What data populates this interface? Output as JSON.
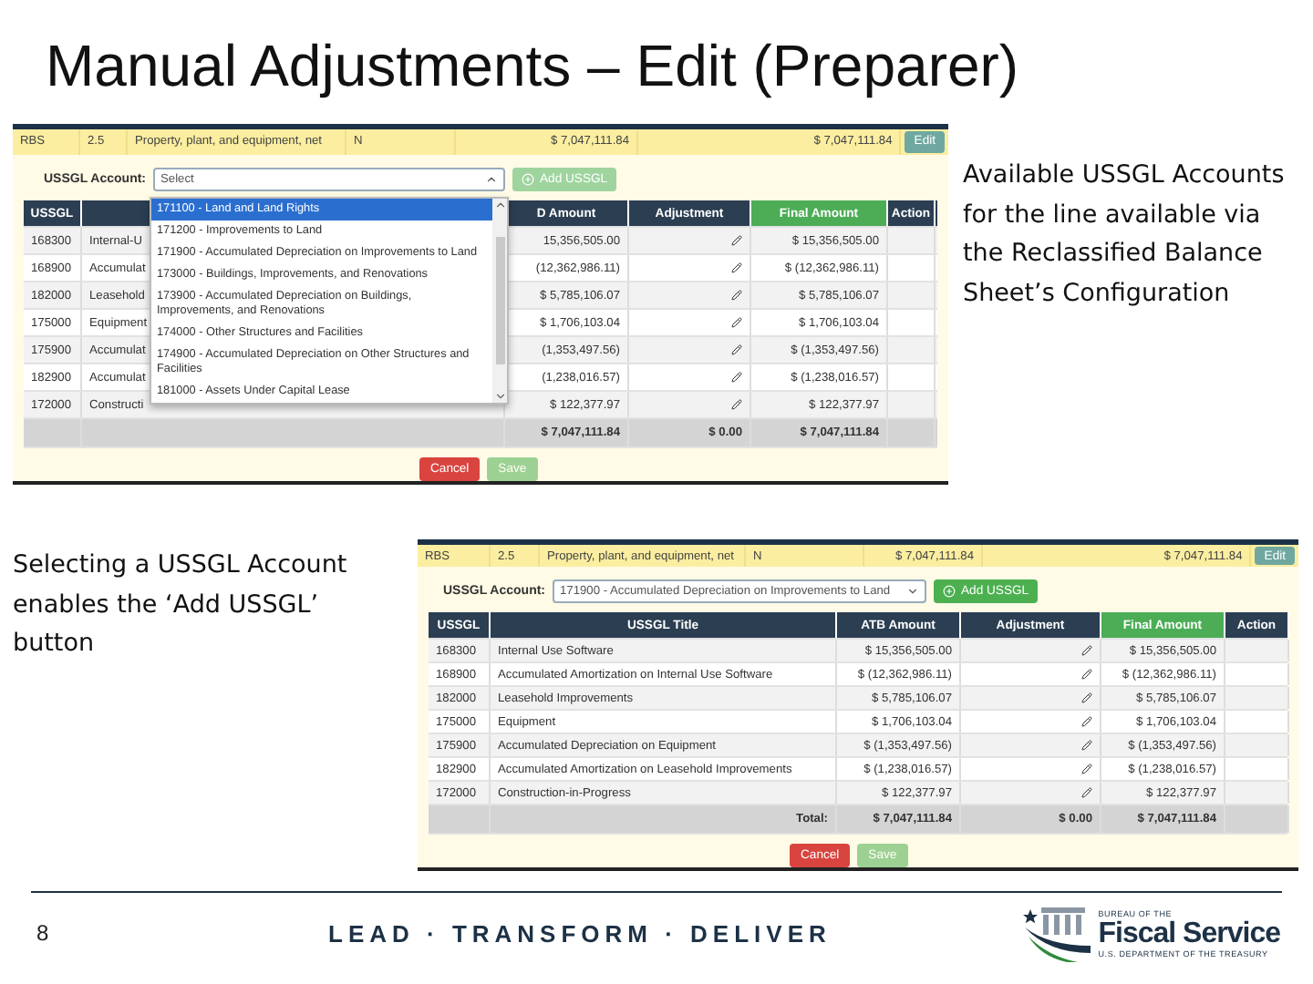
{
  "title": "Manual Adjustments – Edit (Preparer)",
  "notes": [
    {
      "text": "Available USSGL Accounts for the line available via the Reclassified Balance Sheet’s Configuration"
    },
    {
      "text": "Selecting a USSGL Account enables the ‘Add USSGL’ button"
    }
  ],
  "screenshots": [
    {
      "summary": [
        "RBS",
        "2.5",
        "Property, plant, and equipment, net",
        "N",
        "$ 7,047,111.84",
        "$ 7,047,111.84"
      ],
      "edit_button": "Edit",
      "account": {
        "label": "USSGL Account:",
        "value": "Select",
        "open": true
      },
      "options": [
        {
          "label": "171100 - Land and Land Rights",
          "selected": true
        },
        {
          "label": "171200 - Improvements to Land",
          "selected": false
        },
        {
          "label": "171900 - Accumulated Depreciation on Improvements to Land",
          "selected": false
        },
        {
          "label": "173000 - Buildings, Improvements, and Renovations",
          "selected": false
        },
        {
          "label": "173900 - Accumulated Depreciation on Buildings, Improvements, and Renovations",
          "selected": false
        },
        {
          "label": "174000 - Other Structures and Facilities",
          "selected": false
        },
        {
          "label": "174900 - Accumulated Depreciation on Other Structures and Facilities",
          "selected": false
        },
        {
          "label": "181000 - Assets Under Capital Lease",
          "selected": false
        }
      ],
      "add_button": {
        "label": "Add USSGL",
        "disabled": true
      },
      "columns": [
        {
          "label": "USSGL",
          "highlight": false
        },
        {
          "highlight": false
        },
        {
          "label": "D Amount",
          "highlight": false
        },
        {
          "label": "Adjustment",
          "highlight": false
        },
        {
          "label": "Final Amount",
          "highlight": true
        },
        {
          "label": "Action",
          "highlight": false
        }
      ],
      "rows": [
        {
          "ussgl": "168300",
          "title": "Internal-U",
          "atb": "15,356,505.00",
          "final": "$ 15,356,505.00"
        },
        {
          "ussgl": "168900",
          "title": "Accumulat",
          "atb": "(12,362,986.11)",
          "final": "$ (12,362,986.11)"
        },
        {
          "ussgl": "182000",
          "title": "Leasehold",
          "atb": "$ 5,785,106.07",
          "final": "$ 5,785,106.07"
        },
        {
          "ussgl": "175000",
          "title": "Equipment",
          "atb": "$ 1,706,103.04",
          "final": "$ 1,706,103.04"
        },
        {
          "ussgl": "175900",
          "title": "Accumulat",
          "atb": "(1,353,497.56)",
          "final": "$ (1,353,497.56)"
        },
        {
          "ussgl": "182900",
          "title": "Accumulat",
          "atb": "(1,238,016.57)",
          "final": "$ (1,238,016.57)"
        },
        {
          "ussgl": "172000",
          "title": "Constructi",
          "atb": "$ 122,377.97",
          "final": "$ 122,377.97"
        }
      ],
      "total": {
        "atb": "$ 7,047,111.84",
        "adjustment": "$ 0.00",
        "final": "$ 7,047,111.84"
      },
      "buttons": [
        {
          "label": "Cancel",
          "kind": "cancel",
          "disabled": false
        },
        {
          "label": "Save",
          "kind": "save",
          "disabled": true
        }
      ]
    },
    {
      "summary": [
        "RBS",
        "2.5",
        "Property, plant, and equipment, net",
        "N",
        "$ 7,047,111.84",
        "$ 7,047,111.84"
      ],
      "edit_button": "Edit",
      "account": {
        "label": "USSGL Account:",
        "value": "171900 - Accumulated Depreciation on Improvements to Land",
        "open": false
      },
      "add_button": {
        "label": "Add USSGL",
        "disabled": false
      },
      "columns": [
        {
          "label": "USSGL",
          "highlight": false
        },
        {
          "label": "USSGL Title",
          "highlight": false
        },
        {
          "label": "ATB Amount",
          "highlight": false
        },
        {
          "label": "Adjustment",
          "highlight": false
        },
        {
          "label": "Final Amount",
          "highlight": true
        },
        {
          "label": "Action",
          "highlight": false
        }
      ],
      "rows": [
        {
          "ussgl": "168300",
          "title": "Internal Use Software",
          "atb": "$ 15,356,505.00",
          "final": "$ 15,356,505.00"
        },
        {
          "ussgl": "168900",
          "title": "Accumulated Amortization on Internal Use Software",
          "atb": "$ (12,362,986.11)",
          "final": "$ (12,362,986.11)"
        },
        {
          "ussgl": "182000",
          "title": "Leasehold Improvements",
          "atb": "$ 5,785,106.07",
          "final": "$ 5,785,106.07"
        },
        {
          "ussgl": "175000",
          "title": "Equipment",
          "atb": "$ 1,706,103.04",
          "final": "$ 1,706,103.04"
        },
        {
          "ussgl": "175900",
          "title": "Accumulated Depreciation on Equipment",
          "atb": "$ (1,353,497.56)",
          "final": "$ (1,353,497.56)"
        },
        {
          "ussgl": "182900",
          "title": "Accumulated Amortization on Leasehold Improvements",
          "atb": "$ (1,238,016.57)",
          "final": "$ (1,238,016.57)"
        },
        {
          "ussgl": "172000",
          "title": "Construction-in-Progress",
          "atb": "$ 122,377.97",
          "final": "$ 122,377.97"
        }
      ],
      "total": {
        "label": "Total:",
        "atb": "$ 7,047,111.84",
        "adjustment": "$ 0.00",
        "final": "$ 7,047,111.84"
      },
      "buttons": [
        {
          "label": "Cancel",
          "kind": "cancel",
          "disabled": false
        },
        {
          "label": "Save",
          "kind": "save",
          "disabled": true
        }
      ]
    }
  ],
  "footer": {
    "page": "8",
    "motto": "LEAD · TRANSFORM · DELIVER",
    "logo_top": "BUREAU OF THE",
    "logo_name": "Fiscal Service",
    "logo_bottom": "U.S. DEPARTMENT OF THE TREASURY"
  }
}
